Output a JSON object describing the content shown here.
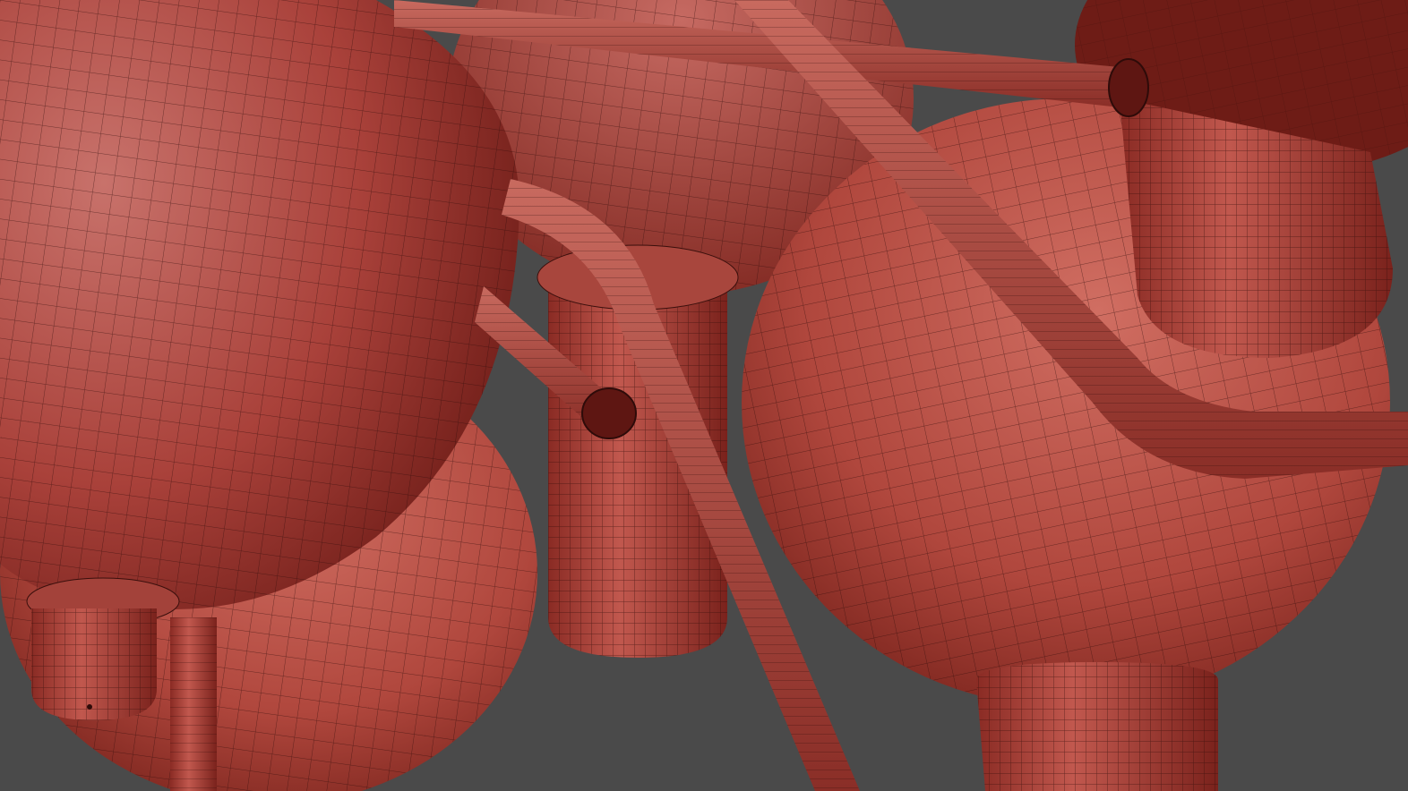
{
  "viewport": {
    "background": "#4a4a4a",
    "mesh_color": "#b5443a",
    "wire_color": "#3a0f0c",
    "highlight_color": "#d97d74",
    "shadow_color": "#5e1612"
  }
}
